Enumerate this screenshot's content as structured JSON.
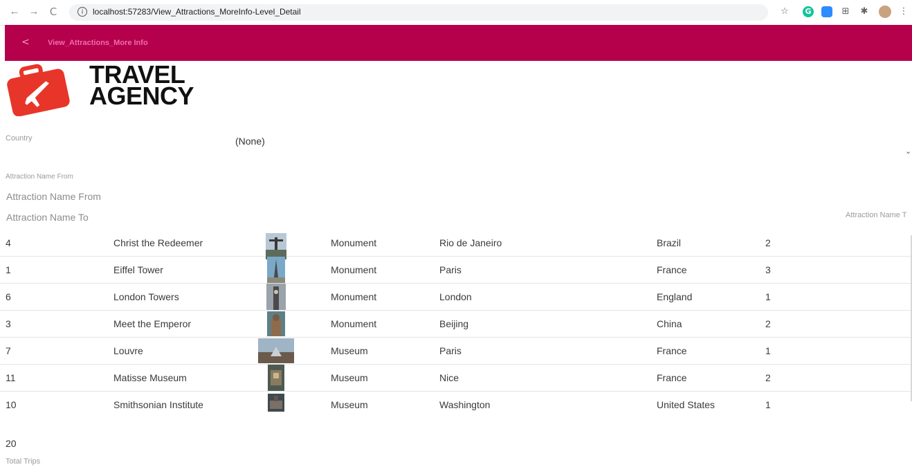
{
  "browser": {
    "url": "localhost:57283/View_Attractions_MoreInfo-Level_Detail",
    "back_glyph": "←",
    "forward_glyph": "→",
    "reload_glyph": "C",
    "info_glyph": "i",
    "extensions": [
      {
        "icon": "star-icon",
        "glyph": "☆"
      },
      {
        "icon": "grammarly-icon",
        "glyph": "G"
      },
      {
        "icon": "zoom-icon",
        "glyph": ""
      },
      {
        "icon": "apps-grid-icon",
        "glyph": "⊞"
      },
      {
        "icon": "extensions-puzzle-icon",
        "glyph": "✱"
      },
      {
        "icon": "profile-avatar-icon",
        "glyph": ""
      },
      {
        "icon": "menu-kebab-icon",
        "glyph": "⋮"
      }
    ]
  },
  "header": {
    "back_glyph": "<",
    "title": "View_Attractions_More Info",
    "color": "#b5004b"
  },
  "logo": {
    "line1": "TRAVEL",
    "line2": "AGENCY",
    "suitcase_color": "#e8352a"
  },
  "filters": {
    "country_label": "Country",
    "country_value": "(None)",
    "from_label": "Attraction Name From",
    "from_placeholder": "Attraction Name From",
    "to_placeholder": "Attraction Name To",
    "to_label_right": "Attraction Name T"
  },
  "rows": [
    {
      "id": "4",
      "name": "Christ the Redeemer",
      "category": "Monument",
      "city": "Rio de Janeiro",
      "country": "Brazil",
      "trips": "2",
      "thumb": "statue"
    },
    {
      "id": "1",
      "name": "Eiffel Tower",
      "category": "Monument",
      "city": "Paris",
      "country": "France",
      "trips": "3",
      "thumb": "tower"
    },
    {
      "id": "6",
      "name": "London Towers",
      "category": "Monument",
      "city": "London",
      "country": "England",
      "trips": "1",
      "thumb": "bigben"
    },
    {
      "id": "3",
      "name": "Meet the Emperor",
      "category": "Monument",
      "city": "Beijing",
      "country": "China",
      "trips": "2",
      "thumb": "warriors"
    },
    {
      "id": "7",
      "name": "Louvre",
      "category": "Museum",
      "city": "Paris",
      "country": "France",
      "trips": "1",
      "thumb": "louvre"
    },
    {
      "id": "11",
      "name": "Matisse Museum",
      "category": "Museum",
      "city": "Nice",
      "country": "France",
      "trips": "2",
      "thumb": "matisse"
    },
    {
      "id": "10",
      "name": "Smithsonian Institute",
      "category": "Museum",
      "city": "Washington",
      "country": "United States",
      "trips": "1",
      "thumb": "smithsonian"
    }
  ],
  "total": {
    "value": "20",
    "label": "Total Trips"
  }
}
